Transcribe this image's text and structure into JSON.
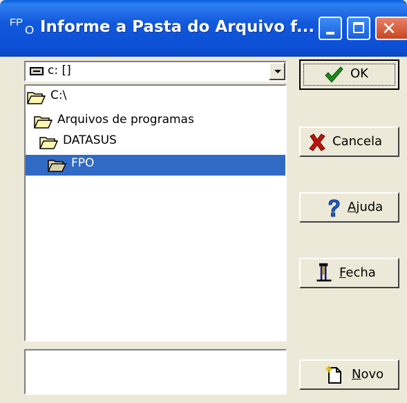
{
  "window": {
    "title": "Informe a Pasta do Arquivo f...",
    "icon_text_top": "FP",
    "icon_text_bottom": "O"
  },
  "drive_combo": {
    "value": "c: []",
    "icon": "drive-icon"
  },
  "folder_tree": {
    "items": [
      {
        "label": "C:\\",
        "icon": "open-folder-icon",
        "selected": false
      },
      {
        "label": "Arquivos de programas",
        "icon": "open-folder-icon",
        "selected": false
      },
      {
        "label": "DATASUS",
        "icon": "open-folder-icon",
        "selected": false
      },
      {
        "label": "FPO",
        "icon": "open-folder-icon",
        "selected": true
      }
    ]
  },
  "filename_field": {
    "value": ""
  },
  "buttons": {
    "ok": {
      "label": "OK",
      "icon": "checkmark-icon"
    },
    "cancela": {
      "label": "Cancela",
      "icon": "x-icon"
    },
    "ajuda_first": "A",
    "ajuda_rest": "juda",
    "ajuda_icon": "question-icon",
    "fecha_first": "F",
    "fecha_rest": "echa",
    "fecha_icon": "door-icon",
    "novo_first": "N",
    "novo_rest": "ovo",
    "novo_icon": "new-document-icon"
  },
  "colors": {
    "titlebar": "#0b4fd4",
    "selection": "#316ac5",
    "face": "#ece9d8"
  }
}
